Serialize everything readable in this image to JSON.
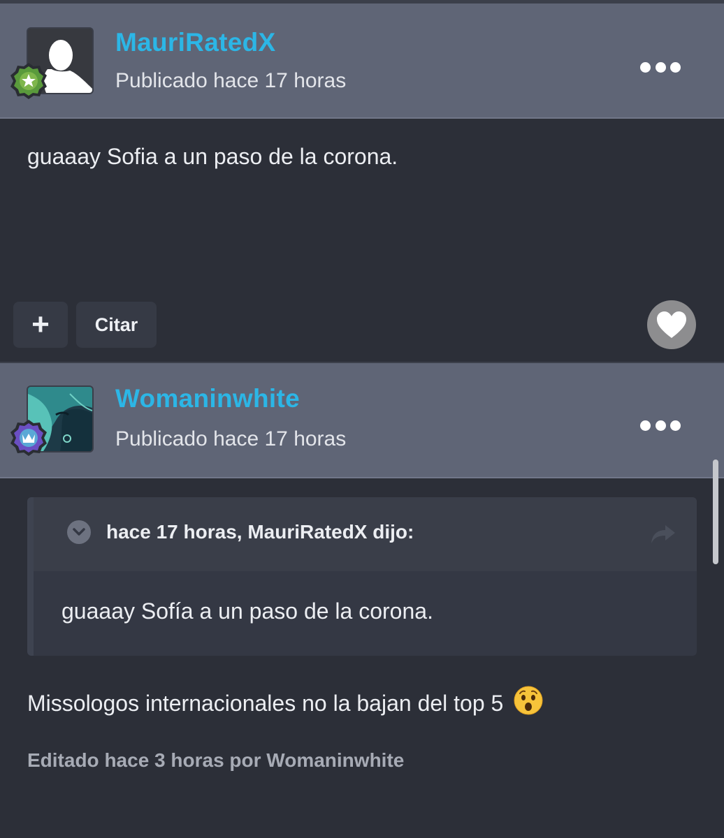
{
  "posts": [
    {
      "author": "MauriRatedX",
      "published": "Publicado hace 17 horas",
      "badge": "star-badge",
      "text": "guaaay Sofia a un paso de la corona.",
      "actions": {
        "add_label": "+",
        "quote_label": "Citar"
      }
    },
    {
      "author": "Womaninwhite",
      "published": "Publicado hace 17 horas",
      "badge": "crown-badge",
      "quote": {
        "header": "hace 17 horas, MauriRatedX dijo:",
        "text": "guaaay Sofía a un paso de la corona."
      },
      "text": "Missologos internacionales no la bajan del top 5",
      "emoji": "hushed-face",
      "edited": "Editado hace 3 horas por Womaninwhite"
    }
  ],
  "colors": {
    "username": "#2cb6e6",
    "header_bg": "#5f6576",
    "page_bg": "#2c2f38"
  },
  "icons": [
    "more-icon",
    "heart-icon",
    "chevron-down-icon",
    "share-arrow-icon",
    "star-badge-icon",
    "crown-badge-icon"
  ]
}
